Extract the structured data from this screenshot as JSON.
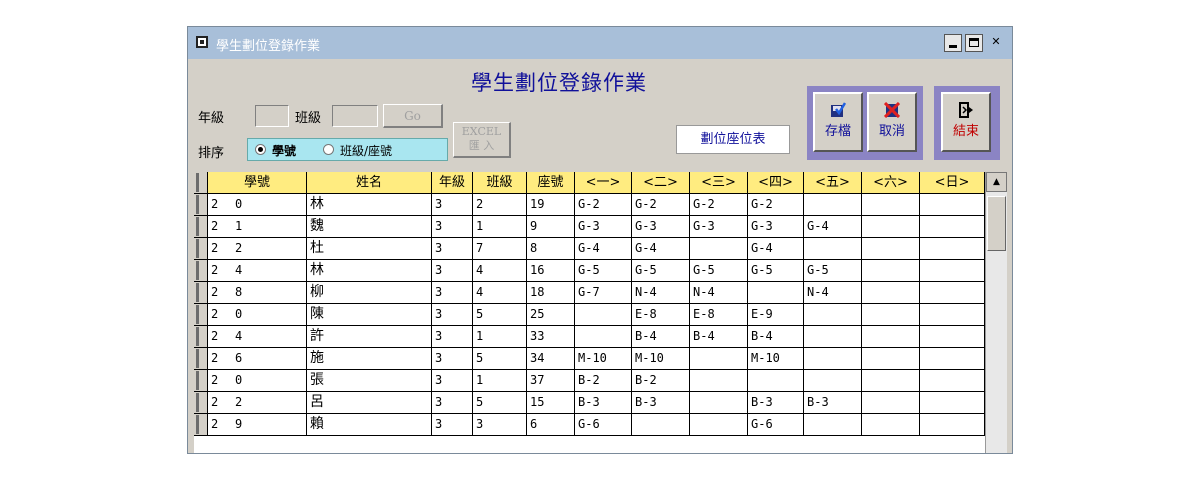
{
  "window": {
    "title": "學生劃位登錄作業"
  },
  "form": {
    "title": "學生劃位登錄作業",
    "grade_label": "年級",
    "class_label": "班級",
    "go_label": "Go",
    "excel_label_1": "EXCEL",
    "excel_label_2": "匯 入",
    "sort_label": "排序",
    "sort_options": [
      "學號",
      "班級/座號"
    ],
    "sort_selected": "學號",
    "seat_table_label": "劃位座位表",
    "save_label": "存檔",
    "cancel_label": "取消",
    "exit_label": "結束"
  },
  "table": {
    "headers": [
      "學號",
      "姓名",
      "年級",
      "班級",
      "座號",
      "<一>",
      "<二>",
      "<三>",
      "<四>",
      "<五>",
      "<六>",
      "<日>"
    ],
    "rows": [
      [
        "2",
        "0",
        "林",
        "3",
        "2",
        "19",
        "G-2",
        "G-2",
        "G-2",
        "G-2",
        "",
        "",
        ""
      ],
      [
        "2",
        "1",
        "魏",
        "3",
        "1",
        "9",
        "G-3",
        "G-3",
        "G-3",
        "G-3",
        "G-4",
        "",
        ""
      ],
      [
        "2",
        "2",
        "杜",
        "3",
        "7",
        "8",
        "G-4",
        "G-4",
        "",
        "G-4",
        "",
        "",
        ""
      ],
      [
        "2",
        "4",
        "林",
        "3",
        "4",
        "16",
        "G-5",
        "G-5",
        "G-5",
        "G-5",
        "G-5",
        "",
        ""
      ],
      [
        "2",
        "8",
        "柳",
        "3",
        "4",
        "18",
        "G-7",
        "N-4",
        "N-4",
        "",
        "N-4",
        "",
        ""
      ],
      [
        "2",
        "0",
        "陳",
        "3",
        "5",
        "25",
        "",
        "E-8",
        "E-8",
        "E-9",
        "",
        "",
        ""
      ],
      [
        "2",
        "4",
        "許",
        "3",
        "1",
        "33",
        "",
        "B-4",
        "B-4",
        "B-4",
        "",
        "",
        ""
      ],
      [
        "2",
        "6",
        "施",
        "3",
        "5",
        "34",
        "M-10",
        "M-10",
        "",
        "M-10",
        "",
        "",
        ""
      ],
      [
        "2",
        "0",
        "張",
        "3",
        "1",
        "37",
        "B-2",
        "B-2",
        "",
        "",
        "",
        "",
        ""
      ],
      [
        "2",
        "2",
        "呂",
        "3",
        "5",
        "15",
        "B-3",
        "B-3",
        "",
        "B-3",
        "B-3",
        "",
        ""
      ],
      [
        "2",
        "9",
        "賴",
        "3",
        "3",
        "6",
        "G-6",
        "",
        "",
        "G-6",
        "",
        "",
        ""
      ]
    ]
  },
  "colors": {
    "title_bar": "#a8bfd9",
    "form_title": "#10109a",
    "header_yellow": "#ffec80",
    "sort_box": "#a9e6f0",
    "action_frame": "#8b84c4",
    "cancel_icon": "#e02020",
    "exit_text": "#c00000"
  }
}
